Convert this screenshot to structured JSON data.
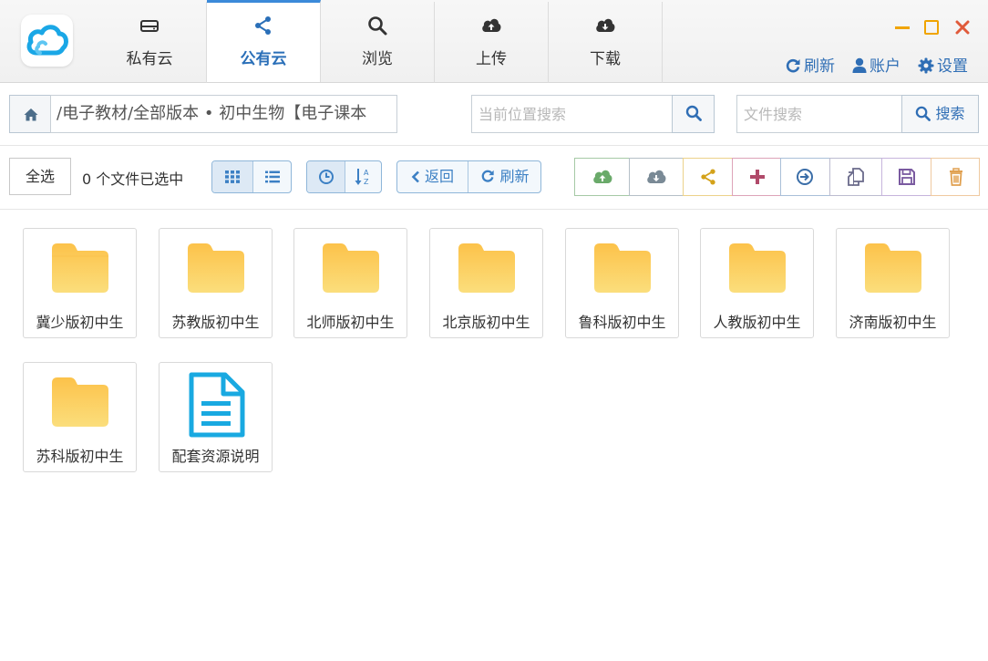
{
  "tabs": [
    {
      "label": "私有云",
      "icon": "drive-icon"
    },
    {
      "label": "公有云",
      "icon": "share-icon",
      "active": true
    },
    {
      "label": "浏览",
      "icon": "search-icon"
    },
    {
      "label": "上传",
      "icon": "cloud-upload-icon"
    },
    {
      "label": "下载",
      "icon": "cloud-download-icon"
    }
  ],
  "header": {
    "refresh_label": "刷新",
    "account_label": "账户",
    "settings_label": "设置"
  },
  "window_controls": {
    "minimize_color": "#f0a400",
    "maximize_color": "#f0a400",
    "close_color": "#e05a3a"
  },
  "path": {
    "text": "/电子教材/全部版本 • 初中生物【电子课本"
  },
  "search": {
    "location_placeholder": "当前位置搜索",
    "file_placeholder": "文件搜索",
    "search_label": "搜索"
  },
  "toolbar": {
    "select_all_label": "全选",
    "selected_count_text": "0 个文件已选中",
    "back_label": "返回",
    "refresh_label": "刷新"
  },
  "action_colors": {
    "upload": "#6aaa6a",
    "download": "#7a8a96",
    "share": "#d4a21a",
    "add": "#b04a6a",
    "move": "#3b6ea8",
    "copy": "#6a6a8a",
    "save": "#7a5aa0",
    "delete": "#e0a050"
  },
  "accent_color": "#2f6eb5",
  "files": [
    {
      "name": "冀少版初中生",
      "type": "folder"
    },
    {
      "name": "苏教版初中生",
      "type": "folder"
    },
    {
      "name": "北师版初中生",
      "type": "folder"
    },
    {
      "name": "北京版初中生",
      "type": "folder"
    },
    {
      "name": "鲁科版初中生",
      "type": "folder"
    },
    {
      "name": "人教版初中生",
      "type": "folder"
    },
    {
      "name": "济南版初中生",
      "type": "folder"
    },
    {
      "name": "苏科版初中生",
      "type": "folder"
    },
    {
      "name": "配套资源说明",
      "type": "document"
    }
  ]
}
